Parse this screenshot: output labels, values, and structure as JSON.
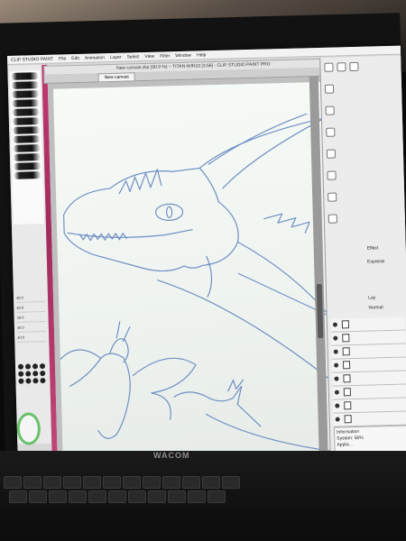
{
  "app": {
    "menu": [
      "CLIP STUDIO PAINT",
      "File",
      "Edit",
      "Animation",
      "Layer",
      "Select",
      "View",
      "Filter",
      "Window",
      "Help"
    ],
    "window_title": "New canvas.clip (90.9 %) ~ TITAN-WIN10 [3:56] - CLIP STUDIO PAINT PRO",
    "canvas_tab": "New canvas"
  },
  "left_panel": {
    "property_values": [
      "40.0",
      "40.0",
      "40.0",
      "40.0",
      "40.0"
    ]
  },
  "right_panel": {
    "effect_label": "Effect",
    "expression_label": "Expressi",
    "layer_label": "Lay",
    "normal_label": "Normal",
    "information": "Information",
    "system": "System: 56%",
    "app_line": "Applic..."
  },
  "device": {
    "brand": "WACOM"
  },
  "colors": {
    "accent_strip": "#c0396f",
    "sketch_line": "#6f8fc4",
    "paper": "#f2f6f2"
  }
}
